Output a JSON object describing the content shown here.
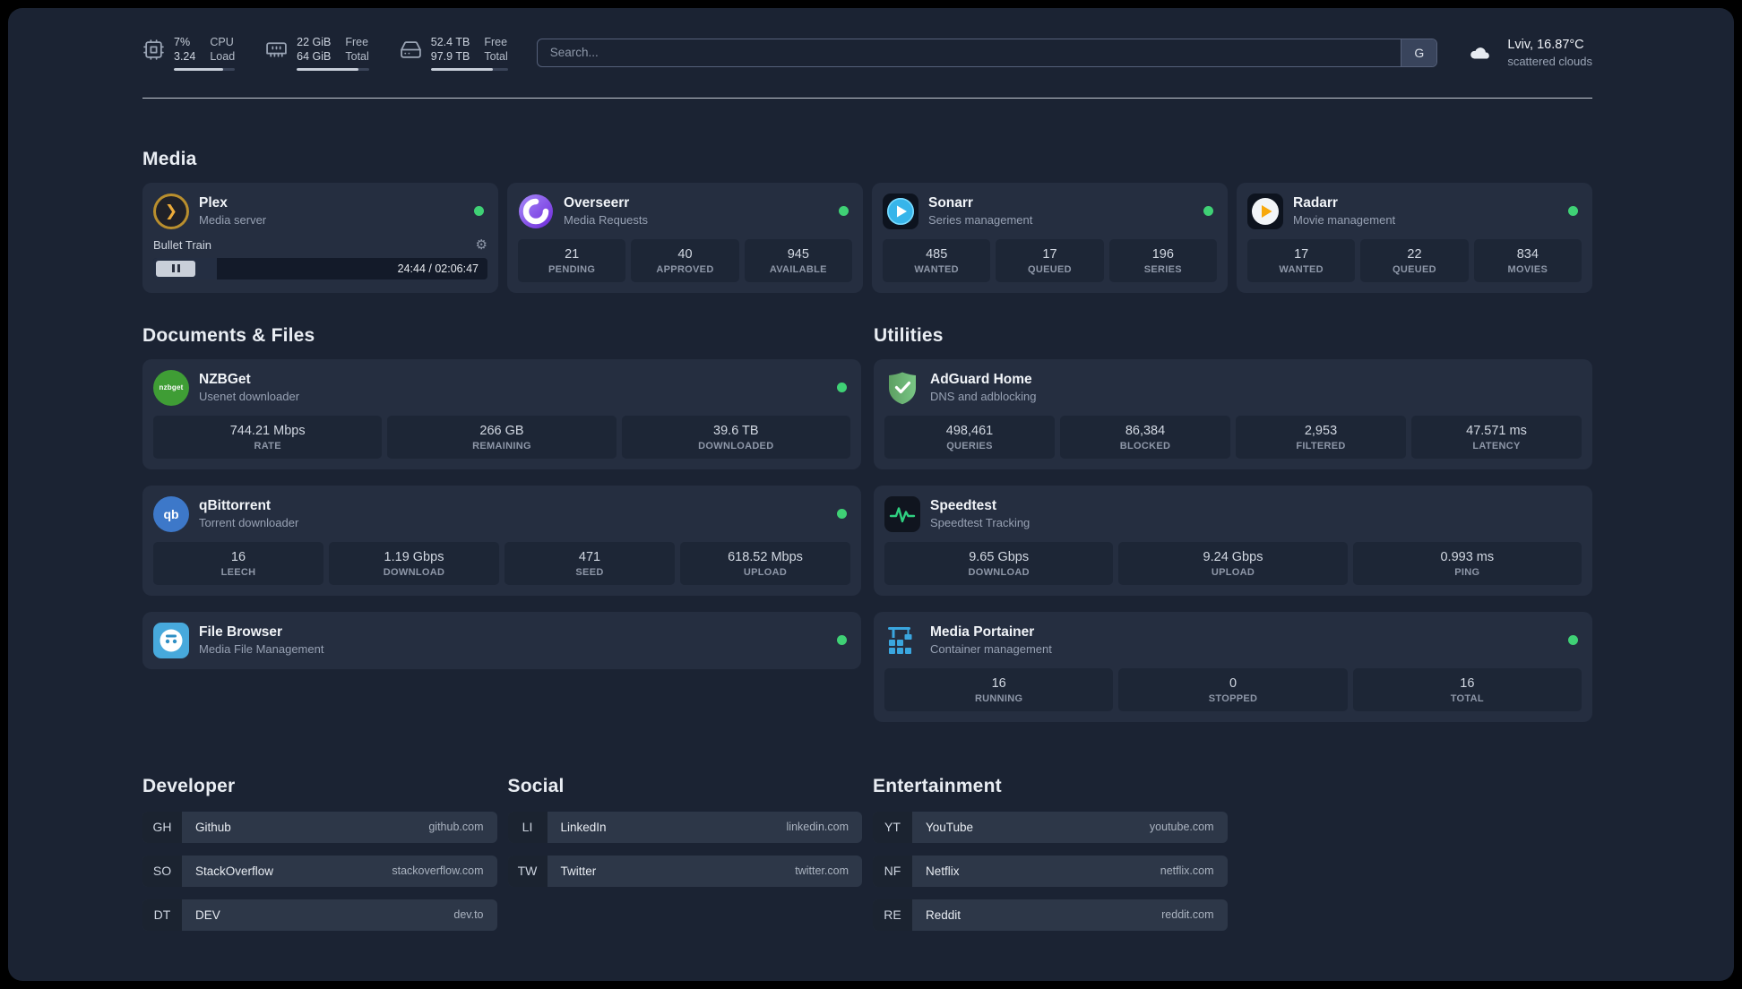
{
  "topbar": {
    "resources": [
      {
        "name": "cpu",
        "value_top": "7%",
        "value_bottom": "3.24",
        "label_top": "CPU",
        "label_bottom": "Load",
        "fill_pct": 80
      },
      {
        "name": "memory",
        "value_top": "22 GiB",
        "value_bottom": "64 GiB",
        "label_top": "Free",
        "label_bottom": "Total",
        "fill_pct": 85
      },
      {
        "name": "disk",
        "value_top": "52.4 TB",
        "value_bottom": "97.9 TB",
        "label_top": "Free",
        "label_bottom": "Total",
        "fill_pct": 80
      }
    ],
    "search_placeholder": "Search...",
    "search_provider": "G",
    "weather_location": "Lviv, 16.87°C",
    "weather_condition": "scattered clouds"
  },
  "sections": {
    "media": {
      "title": "Media",
      "plex": {
        "name": "Plex",
        "desc": "Media server",
        "now_playing": "Bullet Train",
        "time": "24:44 / 02:06:47",
        "progress_pct": 19
      },
      "overseerr": {
        "name": "Overseerr",
        "desc": "Media Requests",
        "stats": [
          {
            "value": "21",
            "label": "PENDING"
          },
          {
            "value": "40",
            "label": "APPROVED"
          },
          {
            "value": "945",
            "label": "AVAILABLE"
          }
        ]
      },
      "sonarr": {
        "name": "Sonarr",
        "desc": "Series management",
        "stats": [
          {
            "value": "485",
            "label": "WANTED"
          },
          {
            "value": "17",
            "label": "QUEUED"
          },
          {
            "value": "196",
            "label": "SERIES"
          }
        ]
      },
      "radarr": {
        "name": "Radarr",
        "desc": "Movie management",
        "stats": [
          {
            "value": "17",
            "label": "WANTED"
          },
          {
            "value": "22",
            "label": "QUEUED"
          },
          {
            "value": "834",
            "label": "MOVIES"
          }
        ]
      }
    },
    "documents": {
      "title": "Documents & Files",
      "nzbget": {
        "name": "NZBGet",
        "desc": "Usenet downloader",
        "stats": [
          {
            "value": "744.21 Mbps",
            "label": "RATE"
          },
          {
            "value": "266 GB",
            "label": "REMAINING"
          },
          {
            "value": "39.6 TB",
            "label": "DOWNLOADED"
          }
        ]
      },
      "qbittorrent": {
        "name": "qBittorrent",
        "desc": "Torrent downloader",
        "stats": [
          {
            "value": "16",
            "label": "LEECH"
          },
          {
            "value": "1.19 Gbps",
            "label": "DOWNLOAD"
          },
          {
            "value": "471",
            "label": "SEED"
          },
          {
            "value": "618.52 Mbps",
            "label": "UPLOAD"
          }
        ]
      },
      "filebrowser": {
        "name": "File Browser",
        "desc": "Media File Management"
      }
    },
    "utilities": {
      "title": "Utilities",
      "adguard": {
        "name": "AdGuard Home",
        "desc": "DNS and adblocking",
        "stats": [
          {
            "value": "498,461",
            "label": "QUERIES"
          },
          {
            "value": "86,384",
            "label": "BLOCKED"
          },
          {
            "value": "2,953",
            "label": "FILTERED"
          },
          {
            "value": "47.571 ms",
            "label": "LATENCY"
          }
        ]
      },
      "speedtest": {
        "name": "Speedtest",
        "desc": "Speedtest Tracking",
        "stats": [
          {
            "value": "9.65 Gbps",
            "label": "DOWNLOAD"
          },
          {
            "value": "9.24 Gbps",
            "label": "UPLOAD"
          },
          {
            "value": "0.993 ms",
            "label": "PING"
          }
        ]
      },
      "portainer": {
        "name": "Media Portainer",
        "desc": "Container management",
        "stats": [
          {
            "value": "16",
            "label": "RUNNING"
          },
          {
            "value": "0",
            "label": "STOPPED"
          },
          {
            "value": "16",
            "label": "TOTAL"
          }
        ]
      }
    },
    "bookmarks": {
      "developer": {
        "title": "Developer",
        "items": [
          {
            "abbr": "GH",
            "name": "Github",
            "url": "github.com"
          },
          {
            "abbr": "SO",
            "name": "StackOverflow",
            "url": "stackoverflow.com"
          },
          {
            "abbr": "DT",
            "name": "DEV",
            "url": "dev.to"
          }
        ]
      },
      "social": {
        "title": "Social",
        "items": [
          {
            "abbr": "LI",
            "name": "LinkedIn",
            "url": "linkedin.com"
          },
          {
            "abbr": "TW",
            "name": "Twitter",
            "url": "twitter.com"
          }
        ]
      },
      "entertainment": {
        "title": "Entertainment",
        "items": [
          {
            "abbr": "YT",
            "name": "YouTube",
            "url": "youtube.com"
          },
          {
            "abbr": "NF",
            "name": "Netflix",
            "url": "netflix.com"
          },
          {
            "abbr": "RE",
            "name": "Reddit",
            "url": "reddit.com"
          }
        ]
      }
    }
  },
  "icons": {
    "plex_glyph": "❯",
    "nzbget_text": "nzbget",
    "qbittorrent_text": "qb",
    "gear_glyph": "⚙"
  },
  "colors": {
    "status_online": "#3fd175",
    "plex": "#e5a00d",
    "overseerr": "#6d28d9",
    "sonarr": "#37b5ea",
    "radarr": "#f7a80c",
    "nzbget": "#3f9d35",
    "qbittorrent": "#3d78c9",
    "filebrowser": "#47a9dc",
    "adguard": "#68b479",
    "speedtest": "#2fd181",
    "portainer": "#3aa6df"
  }
}
